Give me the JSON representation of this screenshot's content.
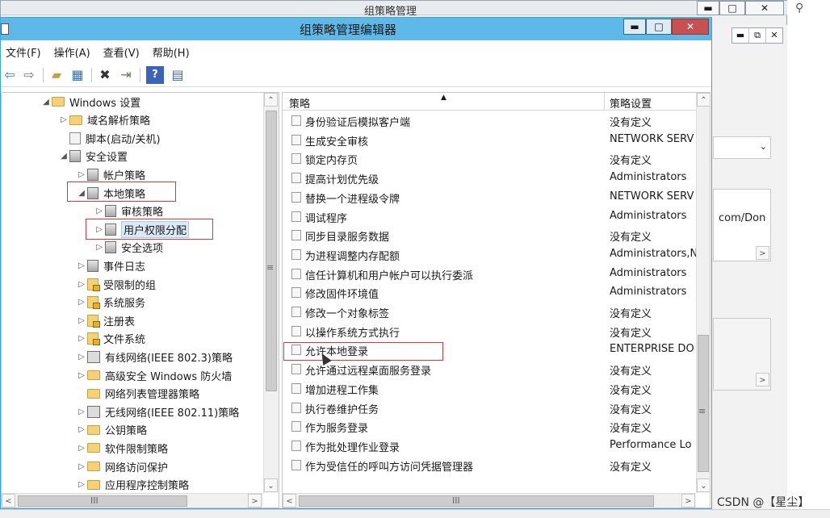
{
  "background_window": {
    "title": "组策略管理",
    "controls": {
      "minimize": "▬",
      "maximize": "□",
      "close": "✕"
    },
    "inner_controls": [
      "▬",
      "⧉",
      "✕"
    ],
    "partial_text_1": "com/Don",
    "scroll_right": ">"
  },
  "window": {
    "title": "组策略管理编辑器",
    "controls": {
      "minimize": "▬",
      "maximize": "□",
      "close": "✕"
    }
  },
  "menu": [
    "文件(F)",
    "操作(A)",
    "查看(V)",
    "帮助(H)"
  ],
  "toolbar": {
    "icons": [
      "back-icon",
      "forward-icon",
      "up-folder-icon",
      "show-hide-tree-icon",
      "delete-icon",
      "export-icon",
      "help-icon",
      "properties-icon"
    ]
  },
  "tree": {
    "items": [
      {
        "label": "Windows 设置",
        "level": 0,
        "arrow": "◢",
        "icon": "folder"
      },
      {
        "label": "域名解析策略",
        "level": 1,
        "arrow": "▷",
        "icon": "folder"
      },
      {
        "label": "脚本(启动/关机)",
        "level": 1,
        "arrow": "",
        "icon": "doc"
      },
      {
        "label": "安全设置",
        "level": 1,
        "arrow": "◢",
        "icon": "policy"
      },
      {
        "label": "帐户策略",
        "level": 2,
        "arrow": "▷",
        "icon": "policy"
      },
      {
        "label": "本地策略",
        "level": 2,
        "arrow": "◢",
        "icon": "policy"
      },
      {
        "label": "审核策略",
        "level": 3,
        "arrow": "▷",
        "icon": "policy"
      },
      {
        "label": "用户权限分配",
        "level": 3,
        "arrow": "▷",
        "icon": "policy",
        "selected": true
      },
      {
        "label": "安全选项",
        "level": 3,
        "arrow": "▷",
        "icon": "policy"
      },
      {
        "label": "事件日志",
        "level": 2,
        "arrow": "▷",
        "icon": "policy"
      },
      {
        "label": "受限制的组",
        "level": 2,
        "arrow": "▷",
        "icon": "policy-lock"
      },
      {
        "label": "系统服务",
        "level": 2,
        "arrow": "▷",
        "icon": "policy-lock"
      },
      {
        "label": "注册表",
        "level": 2,
        "arrow": "▷",
        "icon": "policy-lock"
      },
      {
        "label": "文件系统",
        "level": 2,
        "arrow": "▷",
        "icon": "policy-lock"
      },
      {
        "label": "有线网络(IEEE 802.3)策略",
        "level": 2,
        "arrow": "▷",
        "icon": "net"
      },
      {
        "label": "高级安全 Windows 防火墙",
        "level": 2,
        "arrow": "▷",
        "icon": "folder"
      },
      {
        "label": "网络列表管理器策略",
        "level": 2,
        "arrow": "",
        "icon": "folder"
      },
      {
        "label": "无线网络(IEEE 802.11)策略",
        "level": 2,
        "arrow": "▷",
        "icon": "net"
      },
      {
        "label": "公钥策略",
        "level": 2,
        "arrow": "▷",
        "icon": "folder"
      },
      {
        "label": "软件限制策略",
        "level": 2,
        "arrow": "▷",
        "icon": "folder"
      },
      {
        "label": "网络访问保护",
        "level": 2,
        "arrow": "▷",
        "icon": "folder"
      },
      {
        "label": "应用程序控制策略",
        "level": 2,
        "arrow": "▷",
        "icon": "folder"
      }
    ]
  },
  "list": {
    "columns": [
      "策略",
      "策略设置"
    ],
    "rows": [
      {
        "name": "身份验证后模拟客户端",
        "value": "没有定义"
      },
      {
        "name": "生成安全审核",
        "value": "NETWORK SERV"
      },
      {
        "name": "锁定内存页",
        "value": "没有定义"
      },
      {
        "name": "提高计划优先级",
        "value": "Administrators"
      },
      {
        "name": "替换一个进程级令牌",
        "value": "NETWORK SERV"
      },
      {
        "name": "调试程序",
        "value": "Administrators"
      },
      {
        "name": "同步目录服务数据",
        "value": "没有定义"
      },
      {
        "name": "为进程调整内存配额",
        "value": "Administrators,N"
      },
      {
        "name": "信任计算机和用户帐户可以执行委派",
        "value": "Administrators"
      },
      {
        "name": "修改固件环境值",
        "value": "Administrators"
      },
      {
        "name": "修改一个对象标签",
        "value": "没有定义"
      },
      {
        "name": "以操作系统方式执行",
        "value": "没有定义"
      },
      {
        "name": "允许本地登录",
        "value": "ENTERPRISE DO"
      },
      {
        "name": "允许通过远程桌面服务登录",
        "value": "没有定义"
      },
      {
        "name": "增加进程工作集",
        "value": "没有定义"
      },
      {
        "name": "执行卷维护任务",
        "value": "没有定义"
      },
      {
        "name": "作为服务登录",
        "value": "没有定义"
      },
      {
        "name": "作为批处理作业登录",
        "value": "Performance Lo"
      },
      {
        "name": "作为受信任的呼叫方访问凭据管理器",
        "value": "没有定义"
      }
    ]
  },
  "scroll": {
    "up": "⌃",
    "down": "⌄",
    "left": "<",
    "right": ">",
    "grip_v": "≡",
    "grip_h": "III"
  },
  "watermark": "CSDN @【星尘】"
}
